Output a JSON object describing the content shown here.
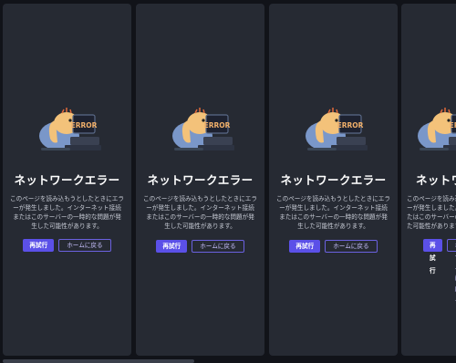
{
  "error_card": {
    "title": "ネットワークエラー",
    "description": "このページを読み込もうとしたときにエラーが発生しました。インターネット接続またはこのサーバーの一時的な問題が発生した可能性があります。",
    "retry_label": "再試行",
    "home_label": "ホームに戻る",
    "illustration_text": "ERROR"
  },
  "colors": {
    "panel_bg": "#262a33",
    "page_bg": "#111319",
    "accent": "#5b50e8",
    "text_primary": "#ffffff",
    "text_secondary": "#c8ccd6"
  },
  "icons": [
    "elephant-at-computer-illustration"
  ]
}
